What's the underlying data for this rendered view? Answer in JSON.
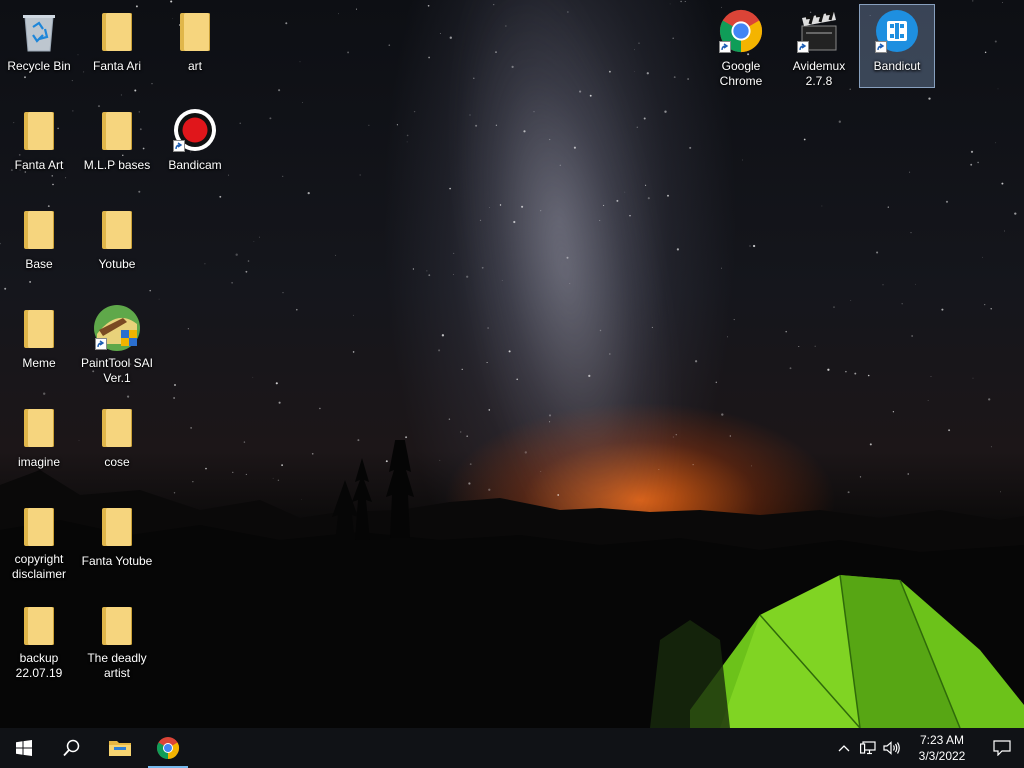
{
  "desktop": {
    "icons": [
      {
        "label": "Recycle Bin",
        "type": "recycle-bin"
      },
      {
        "label": "Fanta Ari",
        "type": "folder"
      },
      {
        "label": "art",
        "type": "folder"
      },
      {
        "label": "Fanta Art",
        "type": "folder"
      },
      {
        "label": "M.L.P bases",
        "type": "folder"
      },
      {
        "label": "Bandicam",
        "type": "bandicam-app"
      },
      {
        "label": "Base",
        "type": "folder"
      },
      {
        "label": "Yotube",
        "type": "folder"
      },
      {
        "label": "Meme",
        "type": "folder"
      },
      {
        "label": "PaintTool SAI Ver.1",
        "type": "painttool-sai-app"
      },
      {
        "label": "imagine",
        "type": "folder"
      },
      {
        "label": "cose",
        "type": "folder"
      },
      {
        "label": "copyright disclaimer",
        "type": "folder"
      },
      {
        "label": "Fanta Yotube",
        "type": "folder"
      },
      {
        "label": "backup 22.07.19",
        "type": "folder"
      },
      {
        "label": "The deadly artist",
        "type": "folder"
      },
      {
        "label": "Google Chrome",
        "type": "chrome-app"
      },
      {
        "label": "Avidemux 2.7.8",
        "type": "avidemux-app"
      },
      {
        "label": "Bandicut",
        "type": "bandicut-app",
        "selected": true
      }
    ]
  },
  "taskbar": {
    "start_icon": "windows-logo-icon",
    "search_icon": "search-icon",
    "pinned": [
      {
        "name": "file-explorer",
        "icon": "folder-icon"
      },
      {
        "name": "google-chrome",
        "icon": "chrome-icon",
        "active": true
      }
    ],
    "tray": {
      "icons": [
        "chevron-up-icon",
        "network-icon",
        "volume-icon"
      ],
      "time": "7:23 AM",
      "date": "3/3/2022",
      "notification_icon": "notification-icon"
    }
  },
  "colors": {
    "taskbar_bg": "#101216",
    "accent": "#76b9ed",
    "folder": "#f6d57e"
  }
}
